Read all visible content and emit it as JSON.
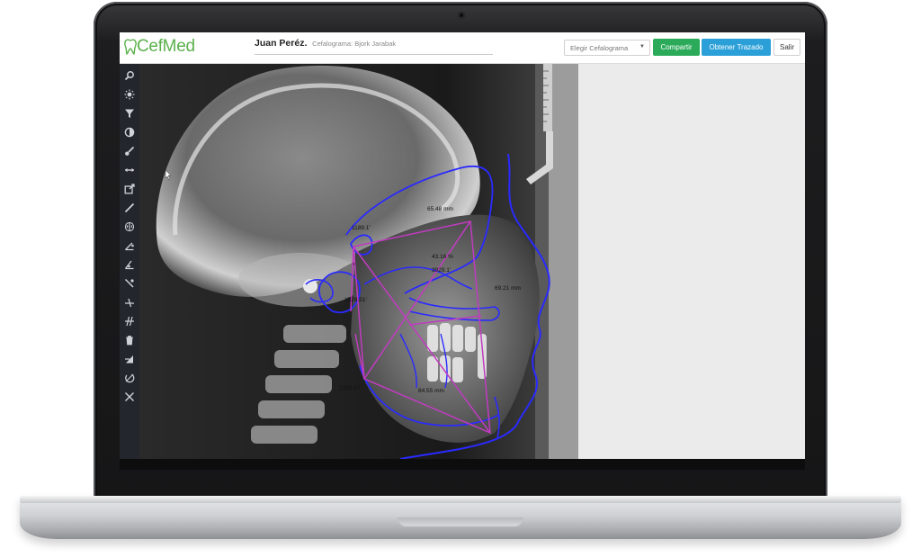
{
  "app": {
    "logo_text": "CefMed",
    "patient_name": "Juan Peréz.",
    "cephalogram_label": "Cefalograma: Bjork Jarabak"
  },
  "header": {
    "select_placeholder": "Elegir Cefalograma",
    "share_label": "Compartir",
    "trace_label": "Obtener Trazado",
    "exit_label": "Salir"
  },
  "toolbar": {
    "tools": [
      "search-icon",
      "brightness-icon",
      "filter-icon",
      "contrast-icon",
      "brush-icon",
      "measure-width-icon",
      "export-icon",
      "line-icon",
      "brain-icon",
      "angle-tool-icon",
      "angle-tool-2-icon",
      "segment-icon",
      "perpendicular-icon",
      "parallel-icon",
      "trash-icon",
      "fill-icon",
      "rotate-icon",
      "close-icon"
    ]
  },
  "measurements": {
    "m1": "1189.1'",
    "m2": "65.48 mm",
    "m3": "43.16 %",
    "m4": "3929.1'",
    "m5": "1529.51'",
    "m6": "69.21 mm",
    "m7": "1232.57'",
    "m8": "84.55 mm"
  },
  "colors": {
    "logo_green": "#5ab04c",
    "share_green": "#2bab5a",
    "trace_blue": "#2a9fd8",
    "tracing_blue": "#2a2aff",
    "tracing_magenta": "#c03cc0"
  }
}
